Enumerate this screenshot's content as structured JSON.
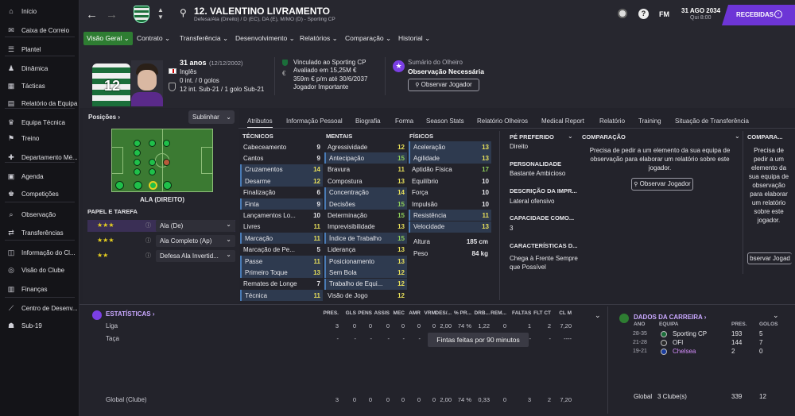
{
  "sidebar": {
    "items": [
      {
        "label": "Início",
        "icon": "home-icon"
      },
      {
        "label": "Caixa de Correio",
        "icon": "inbox-icon"
      },
      {
        "label": "Plantel",
        "icon": "squad-icon"
      },
      {
        "label": "Dinâmica",
        "icon": "dynamics-icon"
      },
      {
        "label": "Tácticas",
        "icon": "tactics-icon"
      },
      {
        "label": "Relatório da Equipa",
        "icon": "report-icon"
      },
      {
        "label": "Equipa Técnica",
        "icon": "staff-icon"
      },
      {
        "label": "Treino",
        "icon": "training-icon"
      },
      {
        "label": "Departamento Mé...",
        "icon": "medical-icon"
      },
      {
        "label": "Agenda",
        "icon": "calendar-icon"
      },
      {
        "label": "Competições",
        "icon": "trophy-icon"
      },
      {
        "label": "Observação",
        "icon": "scouting-icon"
      },
      {
        "label": "Transferências",
        "icon": "transfer-icon"
      },
      {
        "label": "Informação do Cl...",
        "icon": "club-info-icon"
      },
      {
        "label": "Visão do Clube",
        "icon": "vision-icon"
      },
      {
        "label": "Finanças",
        "icon": "finance-icon"
      },
      {
        "label": "Centro de Desenv...",
        "icon": "dev-centre-icon"
      },
      {
        "label": "Sub-19",
        "icon": "u19-icon"
      }
    ]
  },
  "header": {
    "player_name": "12. VALENTINO LIVRAMENTO",
    "subtitle": "Defesa/Ala (Direito) / D (EC), DA (E), M/MO (D) - Sporting CP",
    "fm_label": "FM",
    "date": "31 AGO 2034",
    "day_time": "Qui 8:00",
    "inbox_label": "RECEBIDAS",
    "shirt_number": "12"
  },
  "tabs": [
    "Visão Geral",
    "Contrato",
    "Transferência",
    "Desenvolvimento",
    "Relatórios",
    "Comparação",
    "Historial"
  ],
  "profile": {
    "age": "31 anos",
    "dob": "(12/12/2002)",
    "nationality": "Inglês",
    "intl": "0 int. / 0 golos",
    "u21": "12 int. Sub-21 / 1 golo Sub-21",
    "contract_line1": "Vinculado ao Sporting CP",
    "contract_line2": "Avaliado em 15,25M €",
    "contract_line3": "359m € p/m até 30/6/2037",
    "contract_line4": "Jogador Importante",
    "scout_title": "Sumário do Olheiro",
    "scout_value": "Observação Necessária",
    "scout_button": "Observar Jogador"
  },
  "positions": {
    "title": "Posições",
    "highlight": "Sublinhar",
    "position_label": "ALA (DIREITO)",
    "role_title": "PAPEL E TAREFA",
    "roles": [
      {
        "name": "Ala (De)",
        "stars": "★★★"
      },
      {
        "name": "Ala Completo (Ap)",
        "stars": "★★★"
      },
      {
        "name": "Defesa Ala Invertid...",
        "stars": "★★"
      }
    ]
  },
  "subtabs": [
    "Atributos",
    "Informação Pessoal",
    "Biografia",
    "Forma",
    "Season Stats",
    "Relatório Olheiros",
    "Medical Report",
    "Relatório",
    "Training",
    "Situação de Transferência"
  ],
  "technical": {
    "title": "TÉCNICOS",
    "rows": [
      [
        "Cabeceamento",
        "9"
      ],
      [
        "Cantos",
        "9"
      ],
      [
        "Cruzamentos",
        "14"
      ],
      [
        "Desarme",
        "12"
      ],
      [
        "Finalização",
        "6"
      ],
      [
        "Finta",
        "9"
      ],
      [
        "Lançamentos Lo...",
        "10"
      ],
      [
        "Livres",
        "11"
      ],
      [
        "Marcação",
        "11"
      ],
      [
        "Marcação de Pe...",
        "5"
      ],
      [
        "Passe",
        "11"
      ],
      [
        "Primeiro Toque",
        "13"
      ],
      [
        "Remates de Longe",
        "7"
      ],
      [
        "Técnica",
        "11"
      ]
    ]
  },
  "mental": {
    "title": "MENTAIS",
    "rows": [
      [
        "Agressividade",
        "12"
      ],
      [
        "Antecipação",
        "15"
      ],
      [
        "Bravura",
        "11"
      ],
      [
        "Compostura",
        "13"
      ],
      [
        "Concentração",
        "14"
      ],
      [
        "Decisões",
        "15"
      ],
      [
        "Determinação",
        "15"
      ],
      [
        "Imprevisibilidade",
        "13"
      ],
      [
        "Índice de Trabalho",
        "15"
      ],
      [
        "Liderança",
        "13"
      ],
      [
        "Posicionamento",
        "13"
      ],
      [
        "Sem Bola",
        "12"
      ],
      [
        "Trabalho de Equi...",
        "12"
      ],
      [
        "Visão de Jogo",
        "12"
      ]
    ]
  },
  "physical": {
    "title": "FÍSICOS",
    "rows": [
      [
        "Aceleração",
        "13"
      ],
      [
        "Agilidade",
        "13"
      ],
      [
        "Aptidão Física",
        "17"
      ],
      [
        "Equilíbrio",
        "10"
      ],
      [
        "Força",
        "10"
      ],
      [
        "Impulsão",
        "10"
      ],
      [
        "Resistência",
        "11"
      ],
      [
        "Velocidade",
        "13"
      ]
    ],
    "height_label": "Altura",
    "height": "185 cm",
    "weight_label": "Peso",
    "weight": "84 kg"
  },
  "info": {
    "foot_title": "PÉ PREFERIDO",
    "foot": "Direito",
    "pers_title": "PERSONALIDADE",
    "pers": "Bastante Ambicioso",
    "desc_title": "DESCRIÇÃO DA IMPR...",
    "desc": "Lateral ofensivo",
    "cap_title": "CAPACIDADE COMO...",
    "cap": "3",
    "traits_title": "CARACTERÍSTICAS D...",
    "traits": "Chega à Frente Sempre que Possível"
  },
  "comparison": {
    "title": "COMPARAÇÃO",
    "text": "Precisa de pedir a um elemento da sua equipa de observação para elaborar um relatório sobre este jogador.",
    "button": "Observar Jogador",
    "title2": "COMPARA...",
    "text2": "Precisa de pedir a um elemento da sua equipa de observação para elaborar um relatório sobre este jogador.",
    "button2": "bservar Jogad"
  },
  "stats": {
    "title": "ESTATÍSTICAS",
    "headers": [
      "PRES.",
      "GLS",
      "PENS",
      "ASSIS",
      "MEC",
      "AMR",
      "VRM",
      "DES/...",
      "% PR...",
      "DRB...",
      "REM...",
      "FALTAS",
      "FLT CT",
      "CL M"
    ],
    "rows": [
      {
        "label": "Liga",
        "vals": [
          "3",
          "0",
          "0",
          "0",
          "0",
          "0",
          "0",
          "2,00",
          "74 %",
          "1,22",
          "0",
          "1",
          "2",
          "7,20"
        ]
      },
      {
        "label": "Taça",
        "vals": [
          "-",
          "-",
          "-",
          "-",
          "-",
          "-",
          "-",
          "-",
          "-",
          "-",
          "-",
          "-",
          "-",
          "----"
        ]
      },
      {
        "label": "Global (Clube)",
        "vals": [
          "3",
          "0",
          "0",
          "0",
          "0",
          "0",
          "0",
          "2,00",
          "74 %",
          "0,33",
          "0",
          "3",
          "2",
          "7,20"
        ]
      }
    ],
    "tooltip": "Fintas feitas por 90 minutos"
  },
  "career": {
    "title": "DADOS DA CARREIRA",
    "col_year": "ANO",
    "col_team": "EQUIPA",
    "col_apps": "PRES.",
    "col_goals": "GOLOS",
    "rows": [
      {
        "year": "28-35",
        "team": "Sporting CP",
        "apps": "193",
        "goals": "5"
      },
      {
        "year": "21-28",
        "team": "OFI",
        "apps": "144",
        "goals": "7"
      },
      {
        "year": "19-21",
        "team": "Chelsea",
        "apps": "2",
        "goals": "0"
      }
    ],
    "total_label": "Global",
    "total_clubs": "3 Clube(s)",
    "total_apps": "339",
    "total_goals": "12"
  },
  "colors": {
    "accent": "#7b3fe4",
    "green": "#2e7d32",
    "highlight": "#e8e05a"
  }
}
